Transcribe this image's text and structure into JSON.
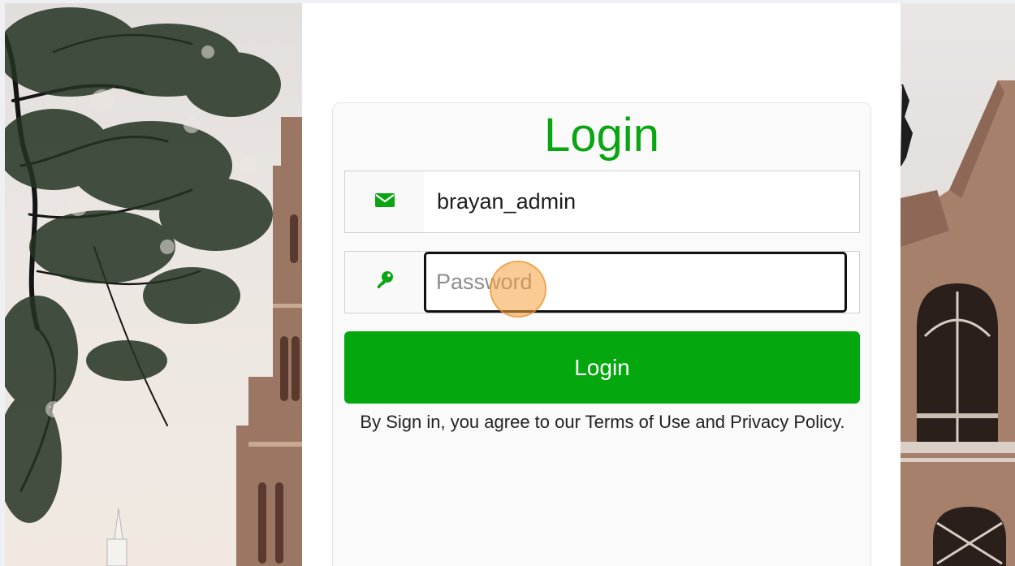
{
  "login": {
    "title": "Login",
    "username_value": "brayan_admin",
    "password_placeholder": "Password",
    "submit_label": "Login",
    "terms_text": "By Sign in, you agree to our Terms of Use and Privacy Policy."
  },
  "icons": {
    "username": "envelope-icon",
    "password": "key-icon"
  },
  "colors": {
    "brand_green": "#05a70f",
    "title_green": "#0aa512"
  }
}
